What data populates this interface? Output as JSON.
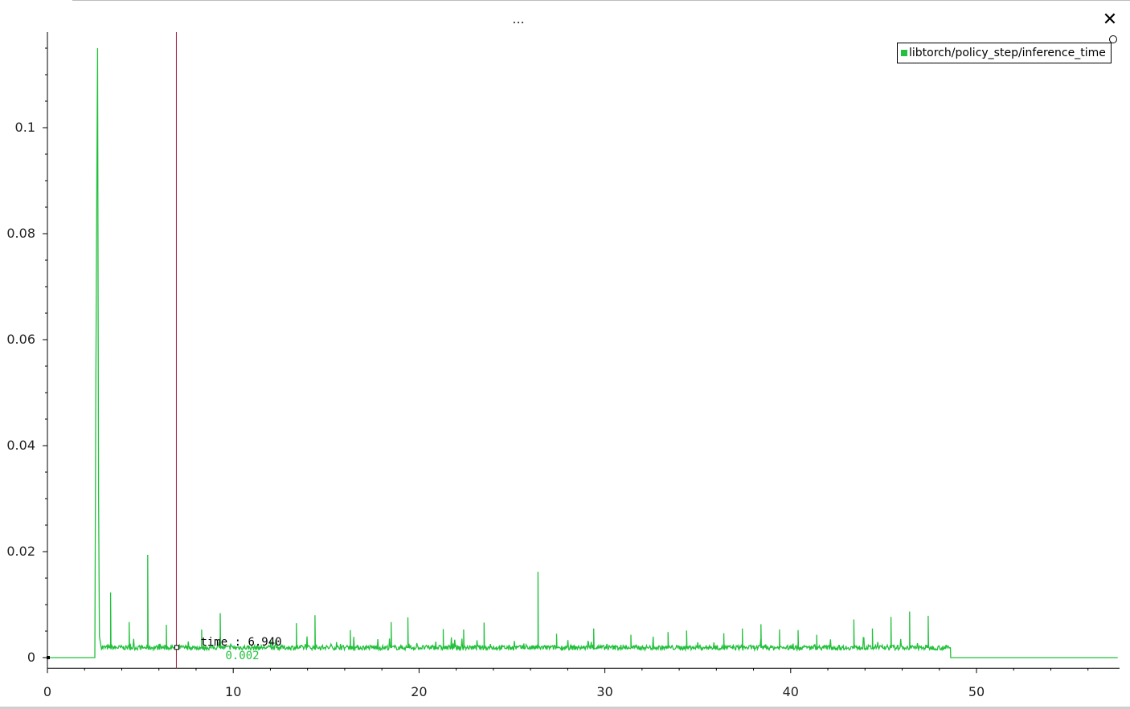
{
  "window": {
    "title": "...",
    "close_label": "✕"
  },
  "colors": {
    "series": "#22c03c",
    "cursor": "#a0203c",
    "axis": "#000000"
  },
  "cursor": {
    "time_label": "time : 6.940",
    "value_label": "0.002",
    "time": 6.94,
    "value": 0.002
  },
  "legend": {
    "entries": [
      "libtorch/policy_step/inference_time"
    ]
  },
  "chart_data": {
    "type": "line",
    "title": "",
    "xlabel": "",
    "ylabel": "",
    "xlim": [
      0,
      57.6
    ],
    "ylim": [
      -0.002,
      0.117
    ],
    "xticks": [
      0,
      10,
      20,
      30,
      40,
      50
    ],
    "yticks": [
      0,
      0.02,
      0.04,
      0.06,
      0.08,
      0.1
    ],
    "xtick_labels": [
      "0",
      "10",
      "20",
      "30",
      "40",
      "50"
    ],
    "ytick_labels": [
      "0",
      "0.02",
      "0.04",
      "0.06",
      "0.08",
      "0.1"
    ],
    "grid": false,
    "legend_position": "top-right",
    "series": [
      {
        "name": "libtorch/policy_step/inference_time",
        "baseline": 0.0018,
        "x": [
          0,
          2.55,
          2.56,
          2.6,
          2.65,
          2.7,
          2.75,
          2.8,
          2.9,
          3.4,
          4.4,
          5.4,
          6.4,
          8.3,
          9.3,
          13.4,
          14.4,
          16.3,
          18.5,
          19.4,
          21.3,
          22.4,
          23.5,
          26.4,
          27.4,
          29.4,
          31.4,
          33.4,
          34.4,
          36.4,
          37.4,
          38.4,
          39.4,
          40.4,
          41.4,
          43.4,
          44.4,
          45.4,
          46.4,
          47.4,
          48.6,
          48.61,
          57.6
        ],
        "y": [
          0,
          0,
          0.0075,
          0.046,
          0.084,
          0.115,
          0.031,
          0.004,
          0.0018,
          0.0123,
          0.0067,
          0.0194,
          0.0062,
          0.0053,
          0.0084,
          0.0065,
          0.008,
          0.0052,
          0.0067,
          0.0076,
          0.0054,
          0.0053,
          0.0066,
          0.0162,
          0.0045,
          0.0055,
          0.0043,
          0.0048,
          0.0051,
          0.0046,
          0.0055,
          0.0063,
          0.0053,
          0.0052,
          0.0043,
          0.0072,
          0.0055,
          0.0077,
          0.0087,
          0.0079,
          0.0022,
          0,
          0
        ]
      }
    ]
  }
}
